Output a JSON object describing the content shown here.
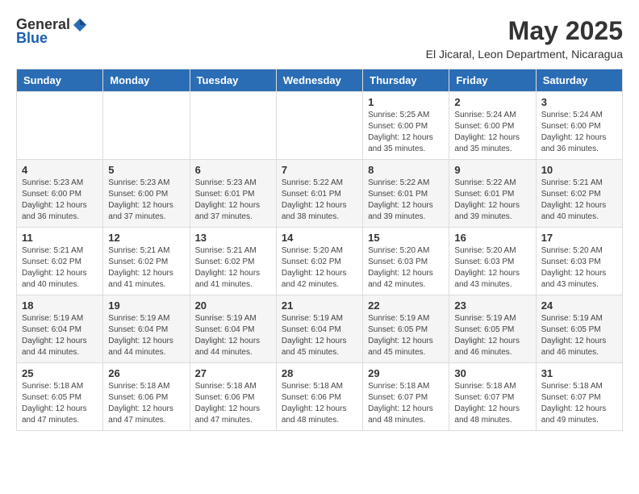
{
  "header": {
    "logo_general": "General",
    "logo_blue": "Blue",
    "title": "May 2025",
    "subtitle": "El Jicaral, Leon Department, Nicaragua"
  },
  "weekdays": [
    "Sunday",
    "Monday",
    "Tuesday",
    "Wednesday",
    "Thursday",
    "Friday",
    "Saturday"
  ],
  "weeks": [
    [
      {
        "day": "",
        "info": ""
      },
      {
        "day": "",
        "info": ""
      },
      {
        "day": "",
        "info": ""
      },
      {
        "day": "",
        "info": ""
      },
      {
        "day": "1",
        "info": "Sunrise: 5:25 AM\nSunset: 6:00 PM\nDaylight: 12 hours\nand 35 minutes."
      },
      {
        "day": "2",
        "info": "Sunrise: 5:24 AM\nSunset: 6:00 PM\nDaylight: 12 hours\nand 35 minutes."
      },
      {
        "day": "3",
        "info": "Sunrise: 5:24 AM\nSunset: 6:00 PM\nDaylight: 12 hours\nand 36 minutes."
      }
    ],
    [
      {
        "day": "4",
        "info": "Sunrise: 5:23 AM\nSunset: 6:00 PM\nDaylight: 12 hours\nand 36 minutes."
      },
      {
        "day": "5",
        "info": "Sunrise: 5:23 AM\nSunset: 6:00 PM\nDaylight: 12 hours\nand 37 minutes."
      },
      {
        "day": "6",
        "info": "Sunrise: 5:23 AM\nSunset: 6:01 PM\nDaylight: 12 hours\nand 37 minutes."
      },
      {
        "day": "7",
        "info": "Sunrise: 5:22 AM\nSunset: 6:01 PM\nDaylight: 12 hours\nand 38 minutes."
      },
      {
        "day": "8",
        "info": "Sunrise: 5:22 AM\nSunset: 6:01 PM\nDaylight: 12 hours\nand 39 minutes."
      },
      {
        "day": "9",
        "info": "Sunrise: 5:22 AM\nSunset: 6:01 PM\nDaylight: 12 hours\nand 39 minutes."
      },
      {
        "day": "10",
        "info": "Sunrise: 5:21 AM\nSunset: 6:02 PM\nDaylight: 12 hours\nand 40 minutes."
      }
    ],
    [
      {
        "day": "11",
        "info": "Sunrise: 5:21 AM\nSunset: 6:02 PM\nDaylight: 12 hours\nand 40 minutes."
      },
      {
        "day": "12",
        "info": "Sunrise: 5:21 AM\nSunset: 6:02 PM\nDaylight: 12 hours\nand 41 minutes."
      },
      {
        "day": "13",
        "info": "Sunrise: 5:21 AM\nSunset: 6:02 PM\nDaylight: 12 hours\nand 41 minutes."
      },
      {
        "day": "14",
        "info": "Sunrise: 5:20 AM\nSunset: 6:02 PM\nDaylight: 12 hours\nand 42 minutes."
      },
      {
        "day": "15",
        "info": "Sunrise: 5:20 AM\nSunset: 6:03 PM\nDaylight: 12 hours\nand 42 minutes."
      },
      {
        "day": "16",
        "info": "Sunrise: 5:20 AM\nSunset: 6:03 PM\nDaylight: 12 hours\nand 43 minutes."
      },
      {
        "day": "17",
        "info": "Sunrise: 5:20 AM\nSunset: 6:03 PM\nDaylight: 12 hours\nand 43 minutes."
      }
    ],
    [
      {
        "day": "18",
        "info": "Sunrise: 5:19 AM\nSunset: 6:04 PM\nDaylight: 12 hours\nand 44 minutes."
      },
      {
        "day": "19",
        "info": "Sunrise: 5:19 AM\nSunset: 6:04 PM\nDaylight: 12 hours\nand 44 minutes."
      },
      {
        "day": "20",
        "info": "Sunrise: 5:19 AM\nSunset: 6:04 PM\nDaylight: 12 hours\nand 44 minutes."
      },
      {
        "day": "21",
        "info": "Sunrise: 5:19 AM\nSunset: 6:04 PM\nDaylight: 12 hours\nand 45 minutes."
      },
      {
        "day": "22",
        "info": "Sunrise: 5:19 AM\nSunset: 6:05 PM\nDaylight: 12 hours\nand 45 minutes."
      },
      {
        "day": "23",
        "info": "Sunrise: 5:19 AM\nSunset: 6:05 PM\nDaylight: 12 hours\nand 46 minutes."
      },
      {
        "day": "24",
        "info": "Sunrise: 5:19 AM\nSunset: 6:05 PM\nDaylight: 12 hours\nand 46 minutes."
      }
    ],
    [
      {
        "day": "25",
        "info": "Sunrise: 5:18 AM\nSunset: 6:05 PM\nDaylight: 12 hours\nand 47 minutes."
      },
      {
        "day": "26",
        "info": "Sunrise: 5:18 AM\nSunset: 6:06 PM\nDaylight: 12 hours\nand 47 minutes."
      },
      {
        "day": "27",
        "info": "Sunrise: 5:18 AM\nSunset: 6:06 PM\nDaylight: 12 hours\nand 47 minutes."
      },
      {
        "day": "28",
        "info": "Sunrise: 5:18 AM\nSunset: 6:06 PM\nDaylight: 12 hours\nand 48 minutes."
      },
      {
        "day": "29",
        "info": "Sunrise: 5:18 AM\nSunset: 6:07 PM\nDaylight: 12 hours\nand 48 minutes."
      },
      {
        "day": "30",
        "info": "Sunrise: 5:18 AM\nSunset: 6:07 PM\nDaylight: 12 hours\nand 48 minutes."
      },
      {
        "day": "31",
        "info": "Sunrise: 5:18 AM\nSunset: 6:07 PM\nDaylight: 12 hours\nand 49 minutes."
      }
    ]
  ]
}
